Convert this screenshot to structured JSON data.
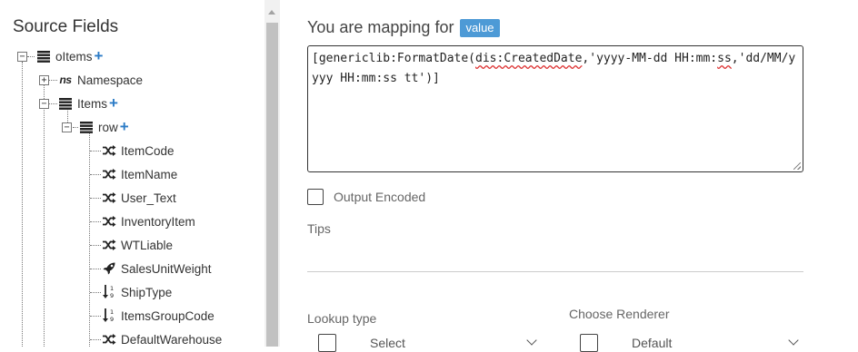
{
  "source_panel": {
    "title": "Source Fields",
    "tree": [
      {
        "label": "oItems",
        "icon": "list-icon",
        "addable": true,
        "toggle": "−"
      },
      {
        "label": "Namespace",
        "icon": "namespace-icon",
        "addable": false,
        "toggle": "+"
      },
      {
        "label": "Items",
        "icon": "list-icon",
        "addable": true,
        "toggle": "−"
      },
      {
        "label": "row",
        "icon": "list-icon",
        "addable": true,
        "toggle": "−"
      },
      {
        "label": "ItemCode",
        "icon": "shuffle-icon"
      },
      {
        "label": "ItemName",
        "icon": "shuffle-icon"
      },
      {
        "label": "User_Text",
        "icon": "shuffle-icon"
      },
      {
        "label": "InventoryItem",
        "icon": "shuffle-icon"
      },
      {
        "label": "WTLiable",
        "icon": "shuffle-icon"
      },
      {
        "label": "SalesUnitWeight",
        "icon": "rocket-icon"
      },
      {
        "label": "ShipType",
        "icon": "numeric-sort-icon"
      },
      {
        "label": "ItemsGroupCode",
        "icon": "numeric-sort-icon"
      },
      {
        "label": "DefaultWarehouse",
        "icon": "shuffle-icon"
      }
    ],
    "add_symbol": "+",
    "ns_glyph": "ns"
  },
  "mapping": {
    "heading": "You are mapping for",
    "target_badge": "value",
    "expression_prefix": "[genericlib:FormatDate(",
    "expression_underlined": "dis:CreatedDate",
    "expression_mid": ",'yyyy-MM-dd HH:mm:",
    "expression_underlined2": "ss",
    "expression_suffix": ",'dd/MM/yyyy HH:mm:ss tt')]"
  },
  "options": {
    "output_encoded_label": "Output Encoded",
    "tips_label": "Tips",
    "lookup_type_label": "Lookup type",
    "lookup_select_value": "Select",
    "renderer_label": "Choose Renderer",
    "renderer_value": "Default"
  },
  "colors": {
    "accent": "#2b7bc6",
    "badge": "#4d9ad6",
    "spellcheck": "#dd3333"
  }
}
